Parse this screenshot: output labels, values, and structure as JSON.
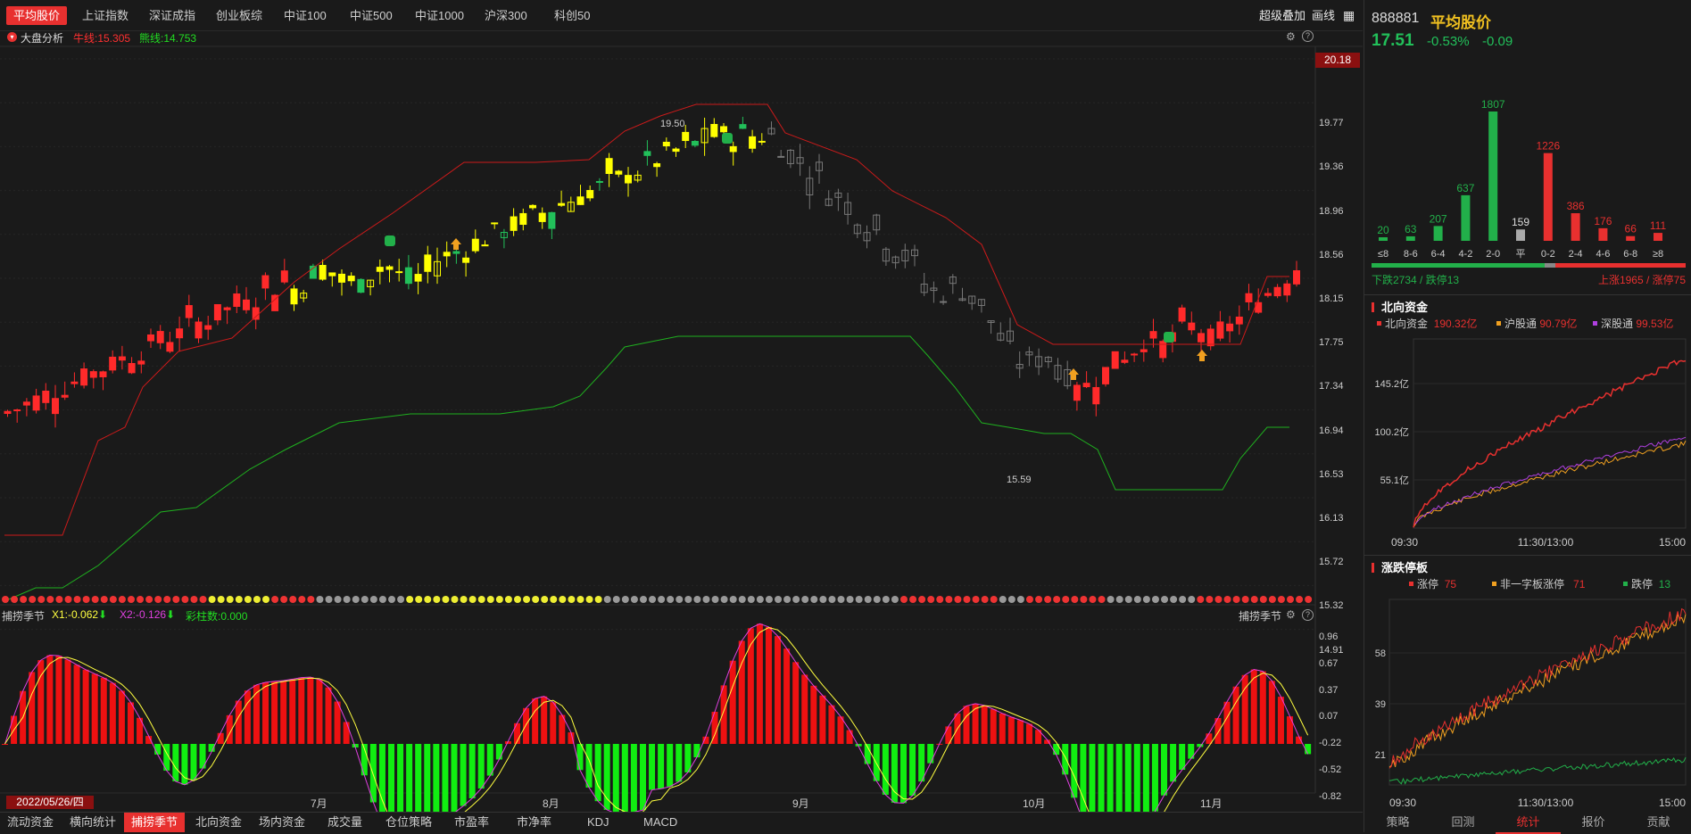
{
  "tabs": [
    "平均股价",
    "上证指数",
    "深证成指",
    "创业板综",
    "中证100",
    "中证500",
    "中证1000",
    "沪深300",
    "科创50"
  ],
  "top_right": {
    "overlay": "超级叠加",
    "draw": "画线"
  },
  "chart_header": {
    "name": "大盘分析",
    "bull_label": "牛线:15.305",
    "bear_label": "熊线:14.753"
  },
  "price_axis": [
    "20.18",
    "19.77",
    "19.36",
    "18.96",
    "18.56",
    "18.15",
    "17.75",
    "17.34",
    "16.94",
    "16.53",
    "16.13",
    "15.72",
    "15.32",
    "14.91"
  ],
  "annotations": {
    "high": "19.50",
    "low": "15.59"
  },
  "indicator_header": {
    "name": "捕捞季节",
    "x1": "X1:-0.062",
    "x2": "X2:-0.126",
    "bars": "彩柱数:0.000",
    "right_name": "捕捞季节"
  },
  "indicator_axis": [
    "0.96",
    "0.67",
    "0.37",
    "0.07",
    "-0.22",
    "-0.52",
    "-0.82"
  ],
  "date_axis": {
    "current": "2022/05/26/四",
    "months": [
      "7月",
      "8月",
      "9月",
      "10月",
      "11月"
    ]
  },
  "bottom_tabs": [
    "流动资金",
    "横向统计",
    "捕捞季节",
    "北向资金",
    "场内资金",
    "成交量",
    "仓位策略",
    "市盈率",
    "市净率",
    "KDJ",
    "MACD"
  ],
  "stock": {
    "code": "888881",
    "name": "平均股价",
    "price": "17.51",
    "pct": "-0.53%",
    "chg": "-0.09"
  },
  "distribution": {
    "labels": [
      "≤8",
      "8-6",
      "6-4",
      "4-2",
      "2-0",
      "平",
      "0-2",
      "2-4",
      "4-6",
      "6-8",
      "≥8"
    ],
    "values": [
      20,
      63,
      207,
      637,
      1807,
      159,
      1226,
      386,
      176,
      66,
      111
    ],
    "down_text": "下跌2734 / 跌停13",
    "up_text": "上涨1965 / 涨停75"
  },
  "north": {
    "title": "北向资金",
    "legend": [
      {
        "name": "北向资金",
        "value": "190.32亿",
        "color": "#e8302f"
      },
      {
        "name": "沪股通",
        "value": "90.79亿",
        "color": "#f0a020"
      },
      {
        "name": "深股通",
        "value": "99.53亿",
        "color": "#b040e0"
      }
    ],
    "yaxis": [
      "145.2亿",
      "100.2亿",
      "55.1亿"
    ],
    "xaxis": [
      "09:30",
      "11:30/13:00",
      "15:00"
    ]
  },
  "limit": {
    "title": "涨跌停板",
    "legend": [
      {
        "name": "涨停",
        "value": "75",
        "color": "#e8302f"
      },
      {
        "name": "非一字板涨停",
        "value": "71",
        "color": "#f0a020"
      },
      {
        "name": "跌停",
        "value": "13",
        "color": "#22b04a"
      }
    ],
    "yaxis": [
      "58",
      "39",
      "21"
    ],
    "xaxis": [
      "09:30",
      "11:30/13:00",
      "15:00"
    ]
  },
  "right_tabs": [
    "策略",
    "回测",
    "统计",
    "报价",
    "贡献"
  ],
  "colors": {
    "up": "#ff2a2a",
    "down": "#22c05a",
    "yellow": "#ffff00",
    "grey": "#777777",
    "accent": "#e8302f"
  }
}
